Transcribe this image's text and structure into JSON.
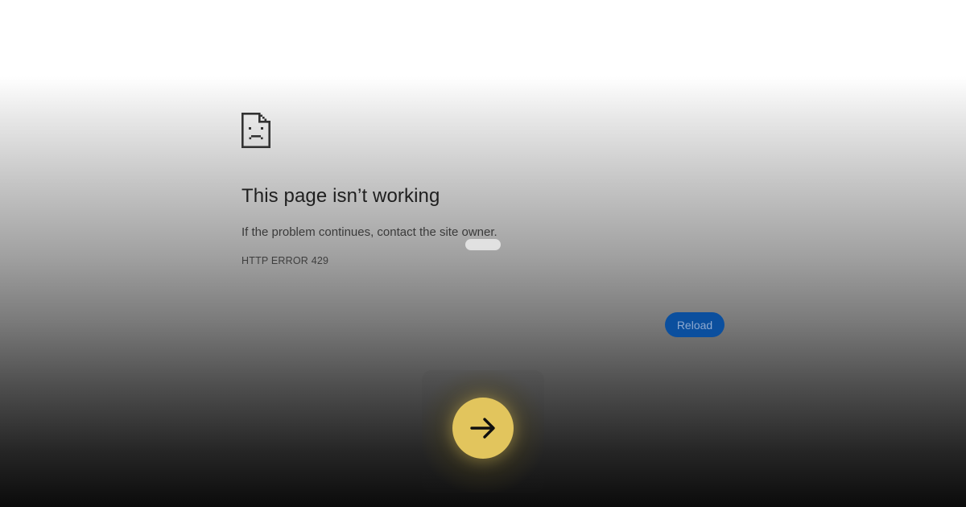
{
  "page": {
    "icon": "sad-page-icon",
    "title": "This page isn’t working",
    "message": "If the problem continues, contact the site owner.",
    "error_code": "HTTP ERROR 429"
  },
  "actions": {
    "reload_label": "Reload",
    "next_icon": "arrow-right-icon"
  },
  "colors": {
    "reload_button": "#0b4f9e",
    "next_button": "#e2c55d",
    "title_text": "#1f1f1f"
  }
}
